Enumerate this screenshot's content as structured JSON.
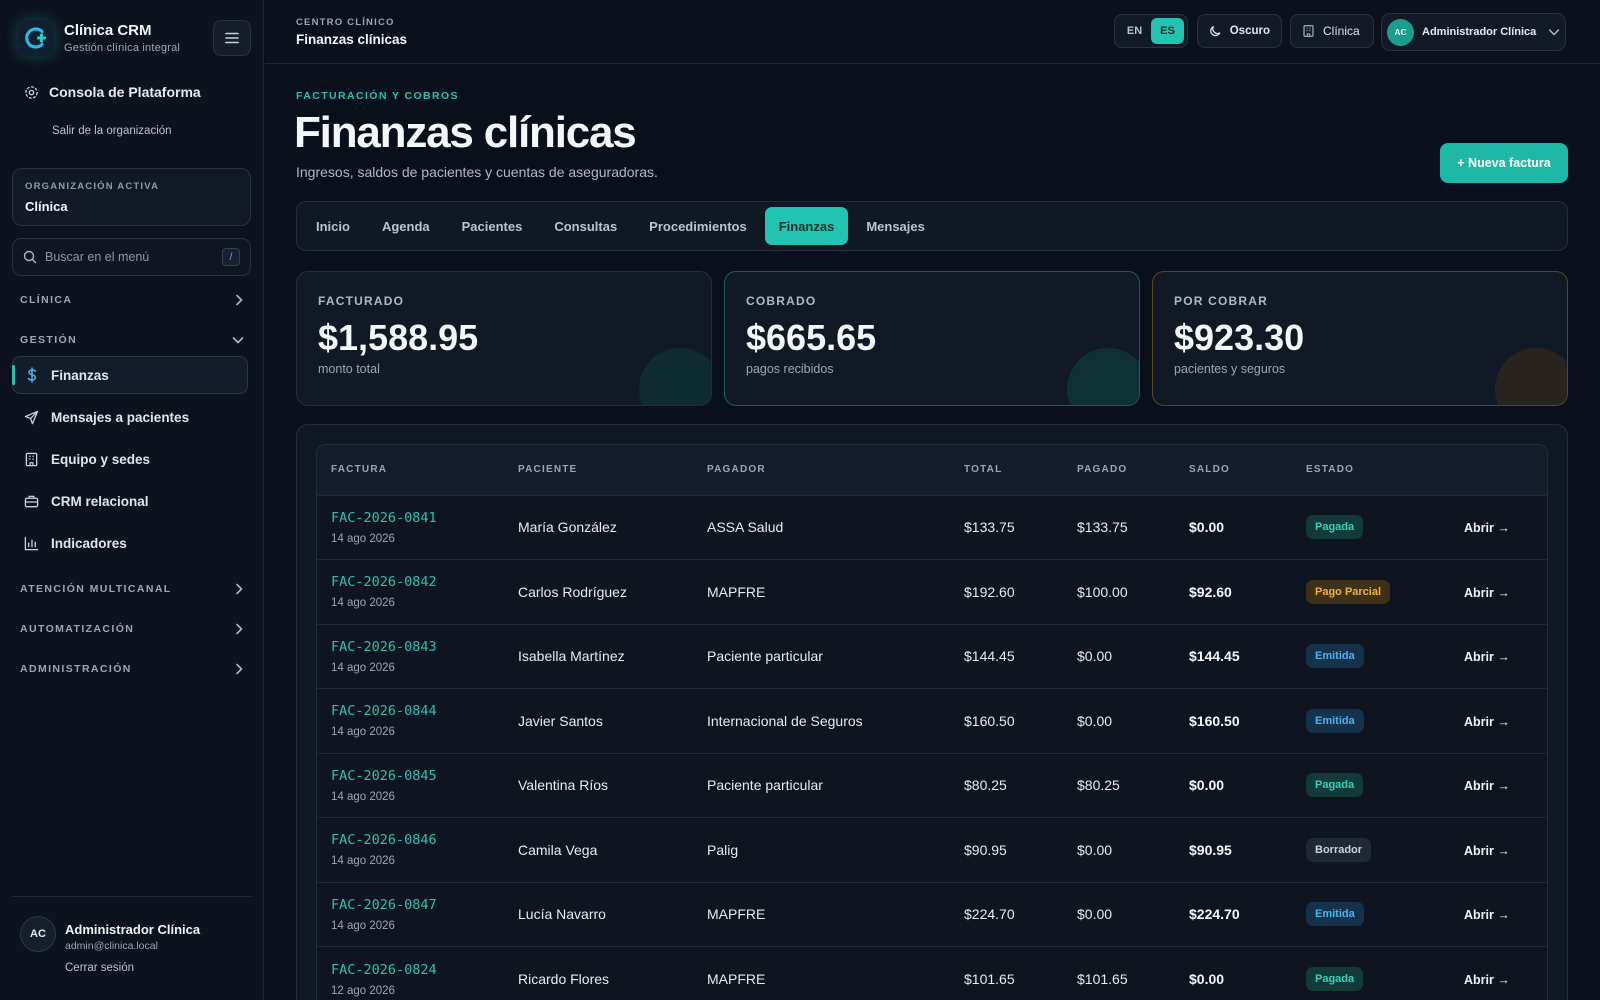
{
  "brand": {
    "name": "Clínica CRM",
    "subtitle": "Gestión clínica integral"
  },
  "sidebar": {
    "platform_label": "Consola de Plataforma",
    "leave_org": "Salir de la organización",
    "org": {
      "label": "ORGANIZACIÓN ACTIVA",
      "value": "Clínica"
    },
    "search": {
      "placeholder": "Buscar en el menú",
      "shortcut": "/"
    },
    "sections": {
      "clinica": "CLÍNICA",
      "gestion": "GESTIÓN",
      "multicanal": "ATENCIÓN MULTICANAL",
      "automatizacion": "AUTOMATIZACIÓN",
      "administracion": "ADMINISTRACIÓN"
    },
    "items": [
      {
        "label": "Finanzas",
        "icon": "dollar-icon",
        "active": true
      },
      {
        "label": "Mensajes a pacientes",
        "icon": "send-icon"
      },
      {
        "label": "Equipo y sedes",
        "icon": "building-icon"
      },
      {
        "label": "CRM relacional",
        "icon": "briefcase-icon"
      },
      {
        "label": "Indicadores",
        "icon": "bar-chart-icon"
      }
    ],
    "user": {
      "initials": "AC",
      "name": "Administrador Clínica",
      "email": "admin@clinica.local",
      "logout": "Cerrar sesión"
    }
  },
  "topbar": {
    "kicker": "CENTRO CLÍNICO",
    "title": "Finanzas clínicas",
    "lang": {
      "en": "EN",
      "es": "ES",
      "active": "ES"
    },
    "theme_label": "Oscuro",
    "org_label": "Clínica",
    "user": {
      "initials": "AC",
      "name": "Administrador Clínica"
    }
  },
  "page": {
    "kicker": "FACTURACIÓN Y COBROS",
    "title": "Finanzas clínicas",
    "subtitle": "Ingresos, saldos de pacientes y cuentas de aseguradoras.",
    "new_invoice": "+ Nueva factura"
  },
  "tabs": [
    "Inicio",
    "Agenda",
    "Pacientes",
    "Consultas",
    "Procedimientos",
    "Finanzas",
    "Mensajes"
  ],
  "active_tab": "Finanzas",
  "stats": [
    {
      "label": "FACTURADO",
      "value": "$1,588.95",
      "note": "monto total"
    },
    {
      "label": "COBRADO",
      "value": "$665.65",
      "note": "pagos recibidos"
    },
    {
      "label": "POR COBRAR",
      "value": "$923.30",
      "note": "pacientes y seguros"
    }
  ],
  "colors": {
    "accent": "#22c4b1",
    "paid": "#2ed3bb",
    "partial": "#f2b33d",
    "issued": "#49b4f2",
    "draft": "#c9d2de"
  },
  "table": {
    "columns": [
      "FACTURA",
      "PACIENTE",
      "PAGADOR",
      "TOTAL",
      "PAGADO",
      "SALDO",
      "ESTADO",
      ""
    ],
    "open_label": "Abrir →",
    "rows": [
      {
        "id": "FAC-2026-0841",
        "date": "14 ago 2026",
        "patient": "María González",
        "payer": "ASSA Salud",
        "total": "$133.75",
        "paid": "$133.75",
        "balance": "$0.00",
        "status": "Pagada",
        "status_kind": "paid"
      },
      {
        "id": "FAC-2026-0842",
        "date": "14 ago 2026",
        "patient": "Carlos Rodríguez",
        "payer": "MAPFRE",
        "total": "$192.60",
        "paid": "$100.00",
        "balance": "$92.60",
        "status": "Pago Parcial",
        "status_kind": "partial"
      },
      {
        "id": "FAC-2026-0843",
        "date": "14 ago 2026",
        "patient": "Isabella Martínez",
        "payer": "Paciente particular",
        "total": "$144.45",
        "paid": "$0.00",
        "balance": "$144.45",
        "status": "Emitida",
        "status_kind": "issued"
      },
      {
        "id": "FAC-2026-0844",
        "date": "14 ago 2026",
        "patient": "Javier Santos",
        "payer": "Internacional de Seguros",
        "total": "$160.50",
        "paid": "$0.00",
        "balance": "$160.50",
        "status": "Emitida",
        "status_kind": "issued"
      },
      {
        "id": "FAC-2026-0845",
        "date": "14 ago 2026",
        "patient": "Valentina Ríos",
        "payer": "Paciente particular",
        "total": "$80.25",
        "paid": "$80.25",
        "balance": "$0.00",
        "status": "Pagada",
        "status_kind": "paid"
      },
      {
        "id": "FAC-2026-0846",
        "date": "14 ago 2026",
        "patient": "Camila Vega",
        "payer": "Palig",
        "total": "$90.95",
        "paid": "$0.00",
        "balance": "$90.95",
        "status": "Borrador",
        "status_kind": "draft"
      },
      {
        "id": "FAC-2026-0847",
        "date": "14 ago 2026",
        "patient": "Lucía Navarro",
        "payer": "MAPFRE",
        "total": "$224.70",
        "paid": "$0.00",
        "balance": "$224.70",
        "status": "Emitida",
        "status_kind": "issued"
      },
      {
        "id": "FAC-2026-0824",
        "date": "12 ago 2026",
        "patient": "Ricardo Flores",
        "payer": "MAPFRE",
        "total": "$101.65",
        "paid": "$101.65",
        "balance": "$0.00",
        "status": "Pagada",
        "status_kind": "paid"
      }
    ]
  }
}
